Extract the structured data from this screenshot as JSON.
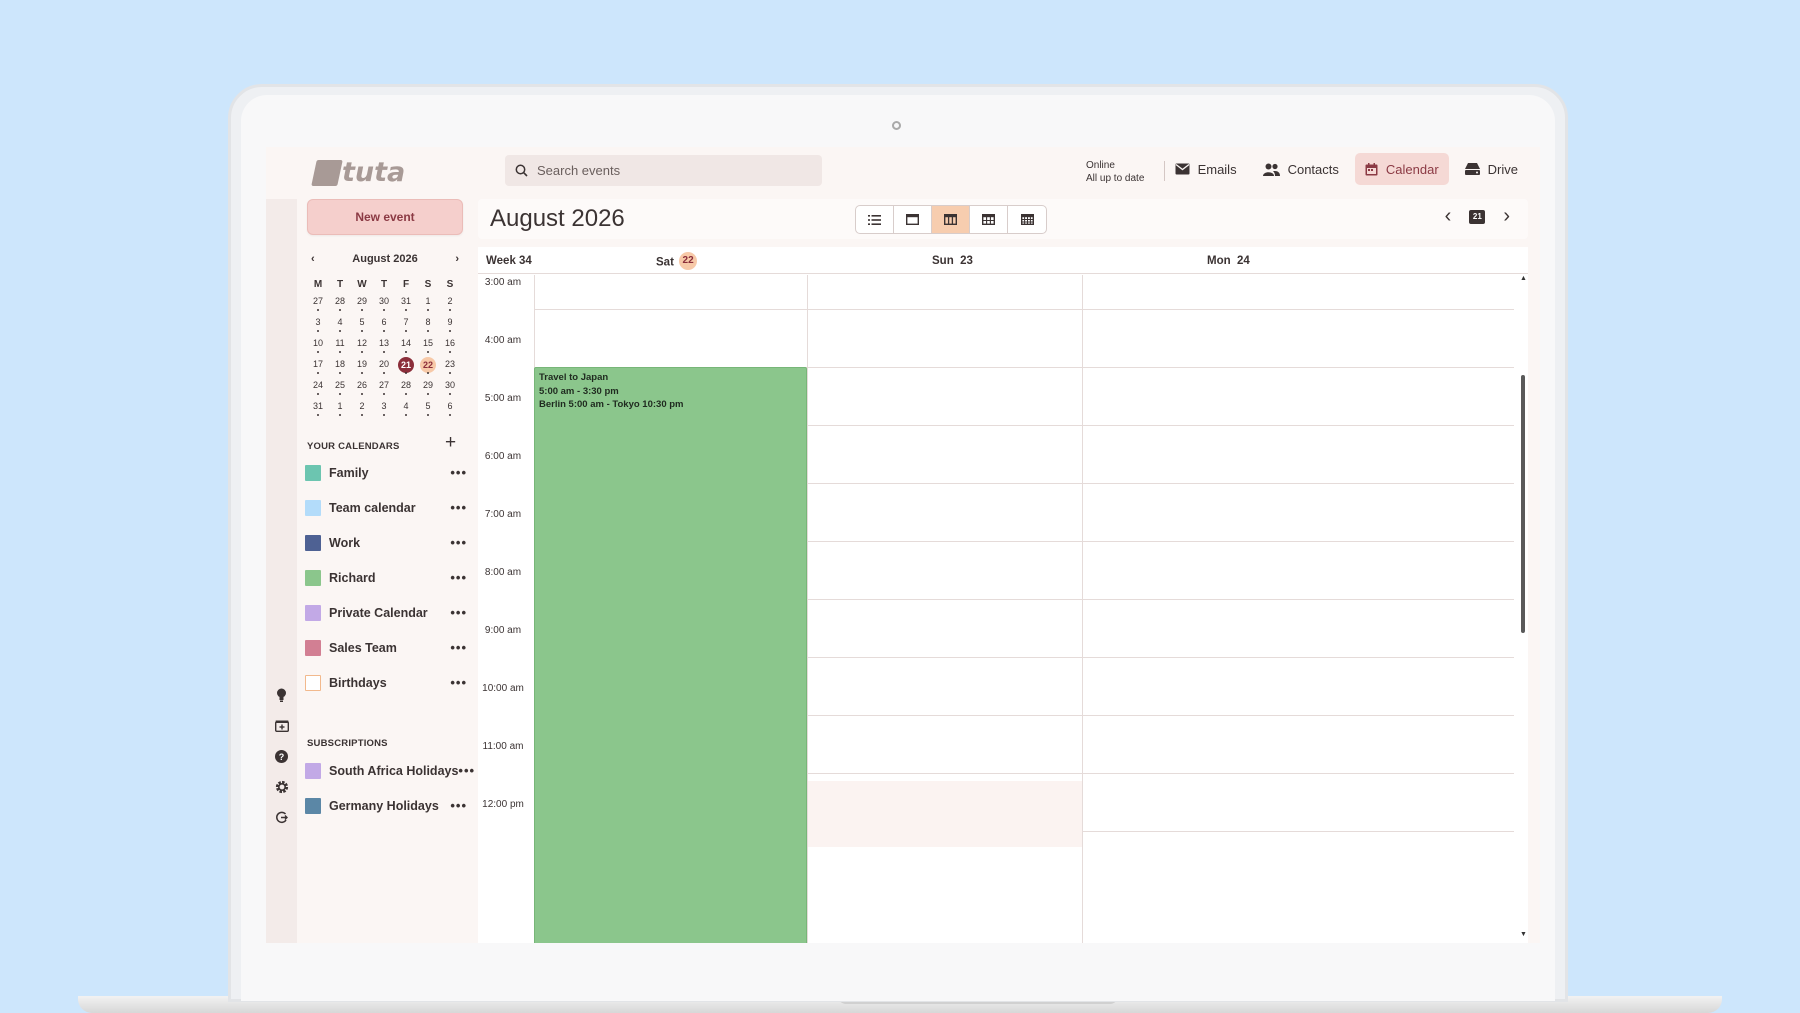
{
  "brand": {
    "name": "tuta"
  },
  "search": {
    "placeholder": "Search events"
  },
  "status": {
    "line1": "Online",
    "line2": "All up to date"
  },
  "topnav": [
    {
      "label": "Emails",
      "icon": "mail-icon"
    },
    {
      "label": "Contacts",
      "icon": "contacts-icon"
    },
    {
      "label": "Calendar",
      "icon": "calendar-icon",
      "active": true
    },
    {
      "label": "Drive",
      "icon": "drive-icon"
    }
  ],
  "sidebar": {
    "new_event_label": "New event",
    "mini_calendar": {
      "month_label": "August 2026",
      "weekdays": [
        "M",
        "T",
        "W",
        "T",
        "F",
        "S",
        "S"
      ],
      "weeks": [
        [
          "27",
          "28",
          "29",
          "30",
          "31",
          "1",
          "2"
        ],
        [
          "3",
          "4",
          "5",
          "6",
          "7",
          "8",
          "9"
        ],
        [
          "10",
          "11",
          "12",
          "13",
          "14",
          "15",
          "16"
        ],
        [
          "17",
          "18",
          "19",
          "20",
          "21",
          "22",
          "23"
        ],
        [
          "24",
          "25",
          "26",
          "27",
          "28",
          "29",
          "30"
        ],
        [
          "31",
          "1",
          "2",
          "3",
          "4",
          "5",
          "6"
        ]
      ],
      "today": "21",
      "selected": "22"
    },
    "your_calendars_title": "YOUR CALENDARS",
    "calendars": [
      {
        "name": "Family",
        "color": "#6cc5b0"
      },
      {
        "name": "Team calendar",
        "color": "#b3dcfa"
      },
      {
        "name": "Work",
        "color": "#4e6193"
      },
      {
        "name": "Richard",
        "color": "#8bc68c"
      },
      {
        "name": "Private Calendar",
        "color": "#c2a9e6"
      },
      {
        "name": "Sales Team",
        "color": "#d27f93"
      },
      {
        "name": "Birthdays",
        "color": "#ffffff",
        "border": "#f2b98d"
      }
    ],
    "subscriptions_title": "SUBSCRIPTIONS",
    "subscriptions": [
      {
        "name": "South Africa Holidays",
        "color": "#c2a9e6"
      },
      {
        "name": "Germany Holidays",
        "color": "#5b87a6"
      }
    ],
    "more_label": "•••"
  },
  "rail_icons": [
    "lightbulb-icon",
    "import-icon",
    "help-icon",
    "settings-icon",
    "logout-icon"
  ],
  "main": {
    "month_title": "August 2026",
    "view_options": [
      "agenda-view-icon",
      "day-view-icon",
      "three-day-view-icon",
      "week-view-icon",
      "month-view-icon"
    ],
    "active_view": "three-day-view-icon",
    "today_day": "21",
    "week_label": "Week 34",
    "days": [
      {
        "name": "Sat",
        "number": "22",
        "selected": true
      },
      {
        "name": "Sun",
        "number": "23"
      },
      {
        "name": "Mon",
        "number": "24"
      }
    ],
    "hours": [
      "3:00 am",
      "4:00 am",
      "5:00 am",
      "6:00 am",
      "7:00 am",
      "8:00 am",
      "9:00 am",
      "10:00 am",
      "11:00 am",
      "12:00 pm"
    ],
    "events": [
      {
        "title": "Travel to Japan",
        "time": "5:00 am - 3:30 pm",
        "detail": "Berlin 5:00 am - Tokyo 10:30 pm",
        "color": "#8bc68c"
      }
    ]
  }
}
